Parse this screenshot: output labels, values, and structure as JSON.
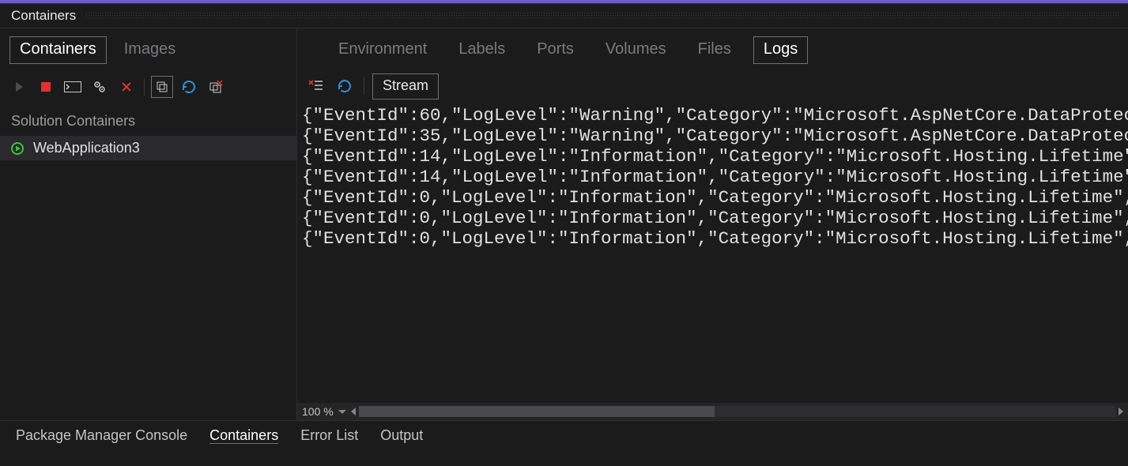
{
  "panel": {
    "title": "Containers"
  },
  "left": {
    "tabs": [
      {
        "label": "Containers",
        "active": true
      },
      {
        "label": "Images",
        "active": false
      }
    ],
    "section_label": "Solution Containers",
    "items": [
      {
        "name": "WebApplication3",
        "status": "running"
      }
    ]
  },
  "right": {
    "tabs": [
      {
        "label": "Environment",
        "active": false
      },
      {
        "label": "Labels",
        "active": false
      },
      {
        "label": "Ports",
        "active": false
      },
      {
        "label": "Volumes",
        "active": false
      },
      {
        "label": "Files",
        "active": false
      },
      {
        "label": "Logs",
        "active": true
      }
    ],
    "stream_label": "Stream",
    "zoom": "100 %",
    "logs": [
      "{\"EventId\":60,\"LogLevel\":\"Warning\",\"Category\":\"Microsoft.AspNetCore.DataProtec",
      "{\"EventId\":35,\"LogLevel\":\"Warning\",\"Category\":\"Microsoft.AspNetCore.DataProtec",
      "{\"EventId\":14,\"LogLevel\":\"Information\",\"Category\":\"Microsoft.Hosting.Lifetime\"",
      "{\"EventId\":14,\"LogLevel\":\"Information\",\"Category\":\"Microsoft.Hosting.Lifetime\"",
      "{\"EventId\":0,\"LogLevel\":\"Information\",\"Category\":\"Microsoft.Hosting.Lifetime\",",
      "{\"EventId\":0,\"LogLevel\":\"Information\",\"Category\":\"Microsoft.Hosting.Lifetime\",",
      "{\"EventId\":0,\"LogLevel\":\"Information\",\"Category\":\"Microsoft.Hosting.Lifetime\","
    ]
  },
  "bottom_tabs": [
    {
      "label": "Package Manager Console",
      "active": false
    },
    {
      "label": "Containers",
      "active": true
    },
    {
      "label": "Error List",
      "active": false
    },
    {
      "label": "Output",
      "active": false
    }
  ]
}
